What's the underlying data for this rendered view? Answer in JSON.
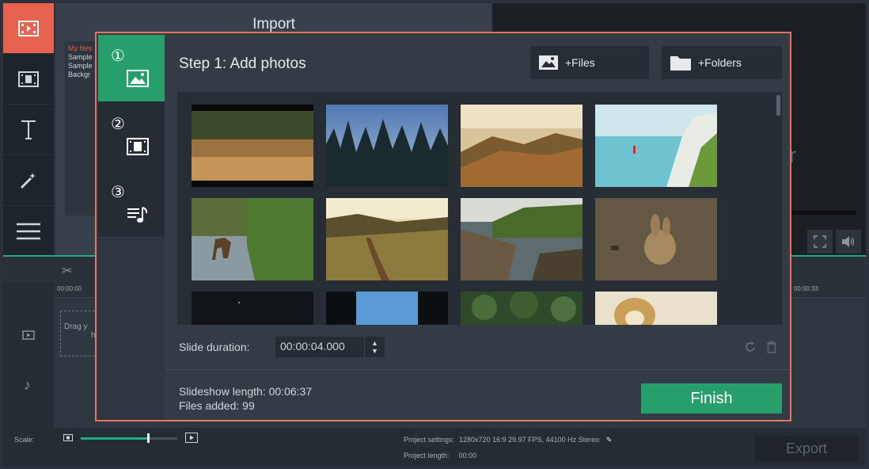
{
  "app": {
    "left_tools": [
      "import-icon",
      "filters-icon",
      "titles-icon",
      "magic-wand-icon",
      "more-tools-icon"
    ],
    "import_title": "Import",
    "file_list": [
      "My files",
      "Sample",
      "Sample",
      "Backgr"
    ]
  },
  "player": {
    "ghost_text": "r"
  },
  "timeline": {
    "time_start": "00:00:00",
    "time_end": "00:00:33",
    "drop_hint_line1": "Drag y",
    "drop_hint_line2": "h"
  },
  "status": {
    "scale_label": "Scale:",
    "scale_level": 0.7,
    "project_settings_label": "Project settings:",
    "project_settings_value": "1280x720 16:9 29.97 FPS, 44100 Hz Stereo",
    "project_length_label": "Project length:",
    "project_length_value": "00:00",
    "export_label": "Export"
  },
  "wizard": {
    "steps": [
      {
        "number": "①",
        "icon": "photo-icon",
        "active": true
      },
      {
        "number": "②",
        "icon": "filmstrip-icon",
        "active": false
      },
      {
        "number": "③",
        "icon": "music-list-icon",
        "active": false
      }
    ],
    "title": "Step 1: Add photos",
    "add_files_label": "+Files",
    "add_folders_label": "+Folders",
    "slide_duration_label": "Slide duration:",
    "slide_duration_value": "00:00:04.000",
    "slideshow_length": "Slideshow length: 00:06:37",
    "files_added": "Files added: 99",
    "finish_label": "Finish",
    "accent_color": "#279f6d",
    "highlight_color": "#e8735f"
  }
}
